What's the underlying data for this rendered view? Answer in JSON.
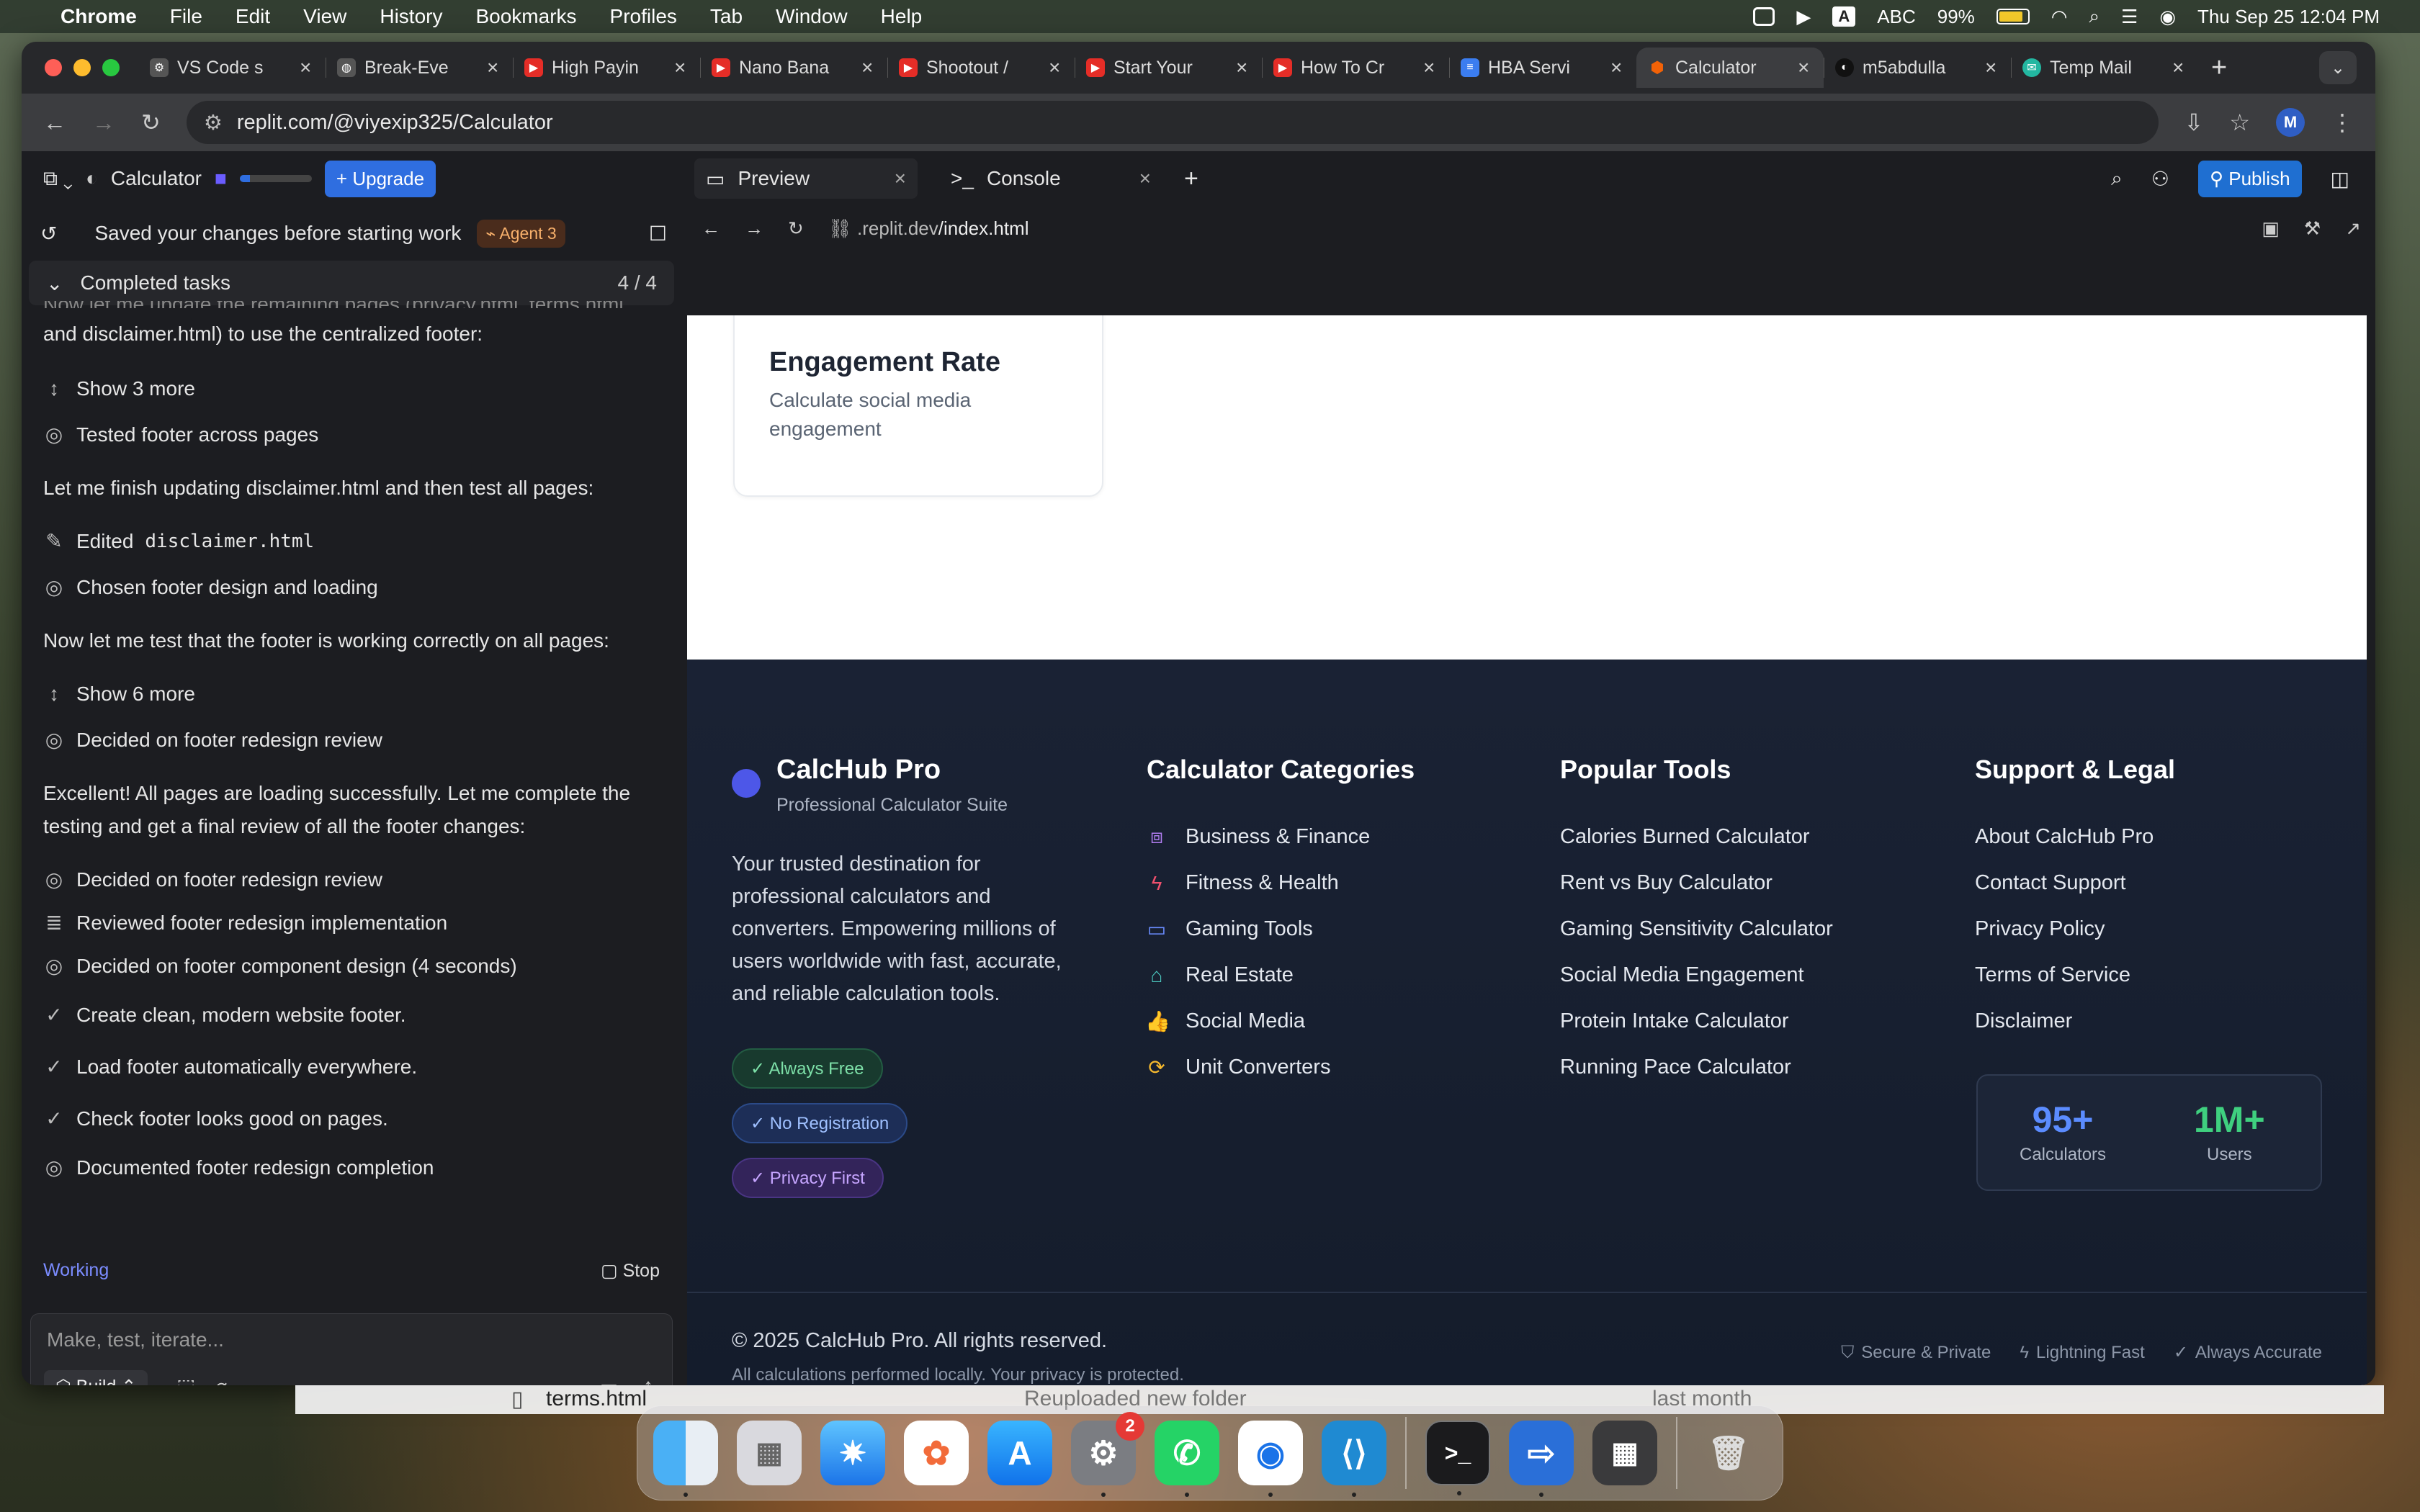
{
  "menubar": {
    "app": "Chrome",
    "items": [
      "File",
      "Edit",
      "View",
      "History",
      "Bookmarks",
      "Profiles",
      "Tab",
      "Window",
      "Help"
    ],
    "input_source": "ABC",
    "battery": "99%",
    "battery_level": 0.99,
    "datetime": "Thu Sep 25  12:04 PM"
  },
  "browser": {
    "tabs": [
      {
        "title": "VS Code s",
        "icon": "vscode-icon"
      },
      {
        "title": "Break-Eve",
        "icon": "globe-icon"
      },
      {
        "title": "High Payin",
        "icon": "youtube-icon"
      },
      {
        "title": "Nano Bana",
        "icon": "youtube-icon"
      },
      {
        "title": "Shootout /",
        "icon": "youtube-icon"
      },
      {
        "title": "Start Your",
        "icon": "youtube-icon"
      },
      {
        "title": "How To Cr",
        "icon": "youtube-icon"
      },
      {
        "title": "HBA Servi",
        "icon": "docs-icon"
      },
      {
        "title": "Calculator",
        "icon": "replit-icon",
        "active": true
      },
      {
        "title": "m5abdulla",
        "icon": "github-icon"
      },
      {
        "title": "Temp Mail",
        "icon": "tempmail-icon"
      }
    ],
    "url": "replit.com/@viyexip325/Calculator",
    "profile_initial": "M"
  },
  "replit": {
    "project": "Calculator",
    "upgrade": "Upgrade",
    "saved_msg": "Saved your changes before starting work",
    "agent_badge": "Agent 3",
    "completed_label": "Completed tasks",
    "completed_count": "4 / 4",
    "chat": {
      "cut_text_1": "Now let me update the remaining pages (privacy.html, terms.html,",
      "cut_text_2": "and disclaimer.html) to use the centralized footer:",
      "show3": "Show 3 more",
      "tested": "Tested footer across pages",
      "finish": "Let me finish updating disclaimer.html and then test all pages:",
      "edited": "Edited",
      "edited_file": "disclaimer.html",
      "chosen": "Chosen footer design and loading",
      "test_msg": "Now let me test that the footer is working correctly on all pages:",
      "show6": "Show 6 more",
      "decided1": "Decided on footer redesign review",
      "excellent_1": "Excellent! All pages are loading successfully. Let me complete the",
      "excellent_2": "testing and get a final review of all the footer changes:",
      "decided2": "Decided on footer redesign review",
      "reviewed": "Reviewed footer redesign implementation",
      "decided3": "Decided on footer component design (4 seconds)",
      "task1": "Create clean, modern website footer.",
      "task2": "Load footer automatically everywhere.",
      "task3": "Check footer looks good on pages.",
      "documented": "Documented footer redesign completion"
    },
    "status": "Working",
    "stop": "Stop",
    "input_placeholder": "Make, test, iterate...",
    "build": "Build",
    "ws_tabs": {
      "preview": "Preview",
      "console": "Console"
    },
    "publish": "Publish",
    "preview_url_host": ".replit.dev",
    "preview_url_path": "/index.html"
  },
  "site": {
    "card_title": "Engagement Rate",
    "card_desc": "Calculate social media engagement",
    "brand": "CalcHub Pro",
    "tagline": "Professional Calculator Suite",
    "description": "Your trusted destination for professional calculators and converters. Empowering millions of users worldwide with fast, accurate, and reliable calculation tools.",
    "pills": [
      "✓ Always Free",
      "✓ No Registration",
      "✓ Privacy First"
    ],
    "categories_title": "Calculator Categories",
    "categories": [
      {
        "label": "Business & Finance",
        "icon": "briefcase-icon",
        "color": "#b07cf0"
      },
      {
        "label": "Fitness & Health",
        "icon": "lightning-icon",
        "color": "#f0506e"
      },
      {
        "label": "Gaming Tools",
        "icon": "monitor-icon",
        "color": "#6a8cff"
      },
      {
        "label": "Real Estate",
        "icon": "home-icon",
        "color": "#4cc9c0"
      },
      {
        "label": "Social Media",
        "icon": "thumbs-up-icon",
        "color": "#f472b6"
      },
      {
        "label": "Unit Converters",
        "icon": "refresh-icon",
        "color": "#f5b82e"
      }
    ],
    "popular_title": "Popular Tools",
    "popular": [
      "Calories Burned Calculator",
      "Rent vs Buy Calculator",
      "Gaming Sensitivity Calculator",
      "Social Media Engagement",
      "Protein Intake Calculator",
      "Running Pace Calculator"
    ],
    "support_title": "Support & Legal",
    "support": [
      "About CalcHub Pro",
      "Contact Support",
      "Privacy Policy",
      "Terms of Service",
      "Disclaimer"
    ],
    "stats": [
      {
        "value": "95+",
        "label": "Calculators",
        "color": "#5b8cff"
      },
      {
        "value": "1M+",
        "label": "Users",
        "color": "#3fd07f"
      }
    ],
    "copyright": "© 2025 CalcHub Pro. All rights reserved.",
    "privacy_note": "All calculations performed locally. Your privacy is protected.",
    "badges": [
      "Secure & Private",
      "Lightning Fast",
      "Always Accurate"
    ]
  },
  "finder_bg": {
    "file": "terms.html",
    "action": "Reuploaded new folder",
    "date": "last month"
  },
  "dock": {
    "settings_badge": "2"
  }
}
